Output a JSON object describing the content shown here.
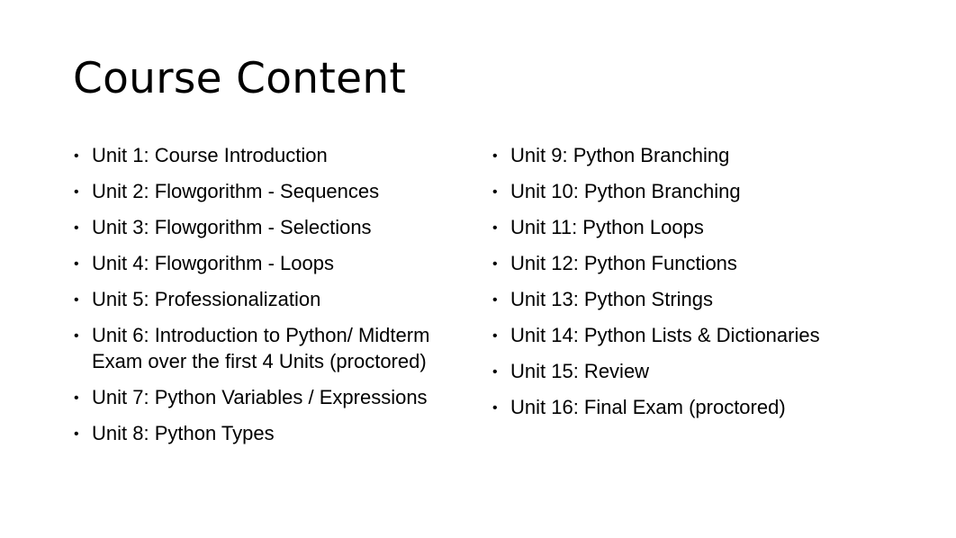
{
  "slide": {
    "title": "Course Content",
    "left_column": [
      "Unit 1: Course Introduction",
      "Unit 2: Flowgorithm - Sequences",
      "Unit 3: Flowgorithm - Selections",
      "Unit 4: Flowgorithm - Loops",
      "Unit 5: Professionalization",
      "Unit 6: Introduction to Python/ Midterm Exam over the first 4 Units (proctored)",
      "Unit 7: Python Variables / Expressions",
      "Unit 8: Python Types"
    ],
    "right_column": [
      "Unit 9: Python Branching",
      "Unit 10: Python Branching",
      "Unit 11: Python Loops",
      "Unit 12: Python Functions",
      "Unit 13: Python Strings",
      "Unit 14: Python Lists & Dictionaries",
      "Unit 15: Review",
      "Unit 16: Final Exam (proctored)"
    ],
    "bullet_glyph": "•"
  }
}
